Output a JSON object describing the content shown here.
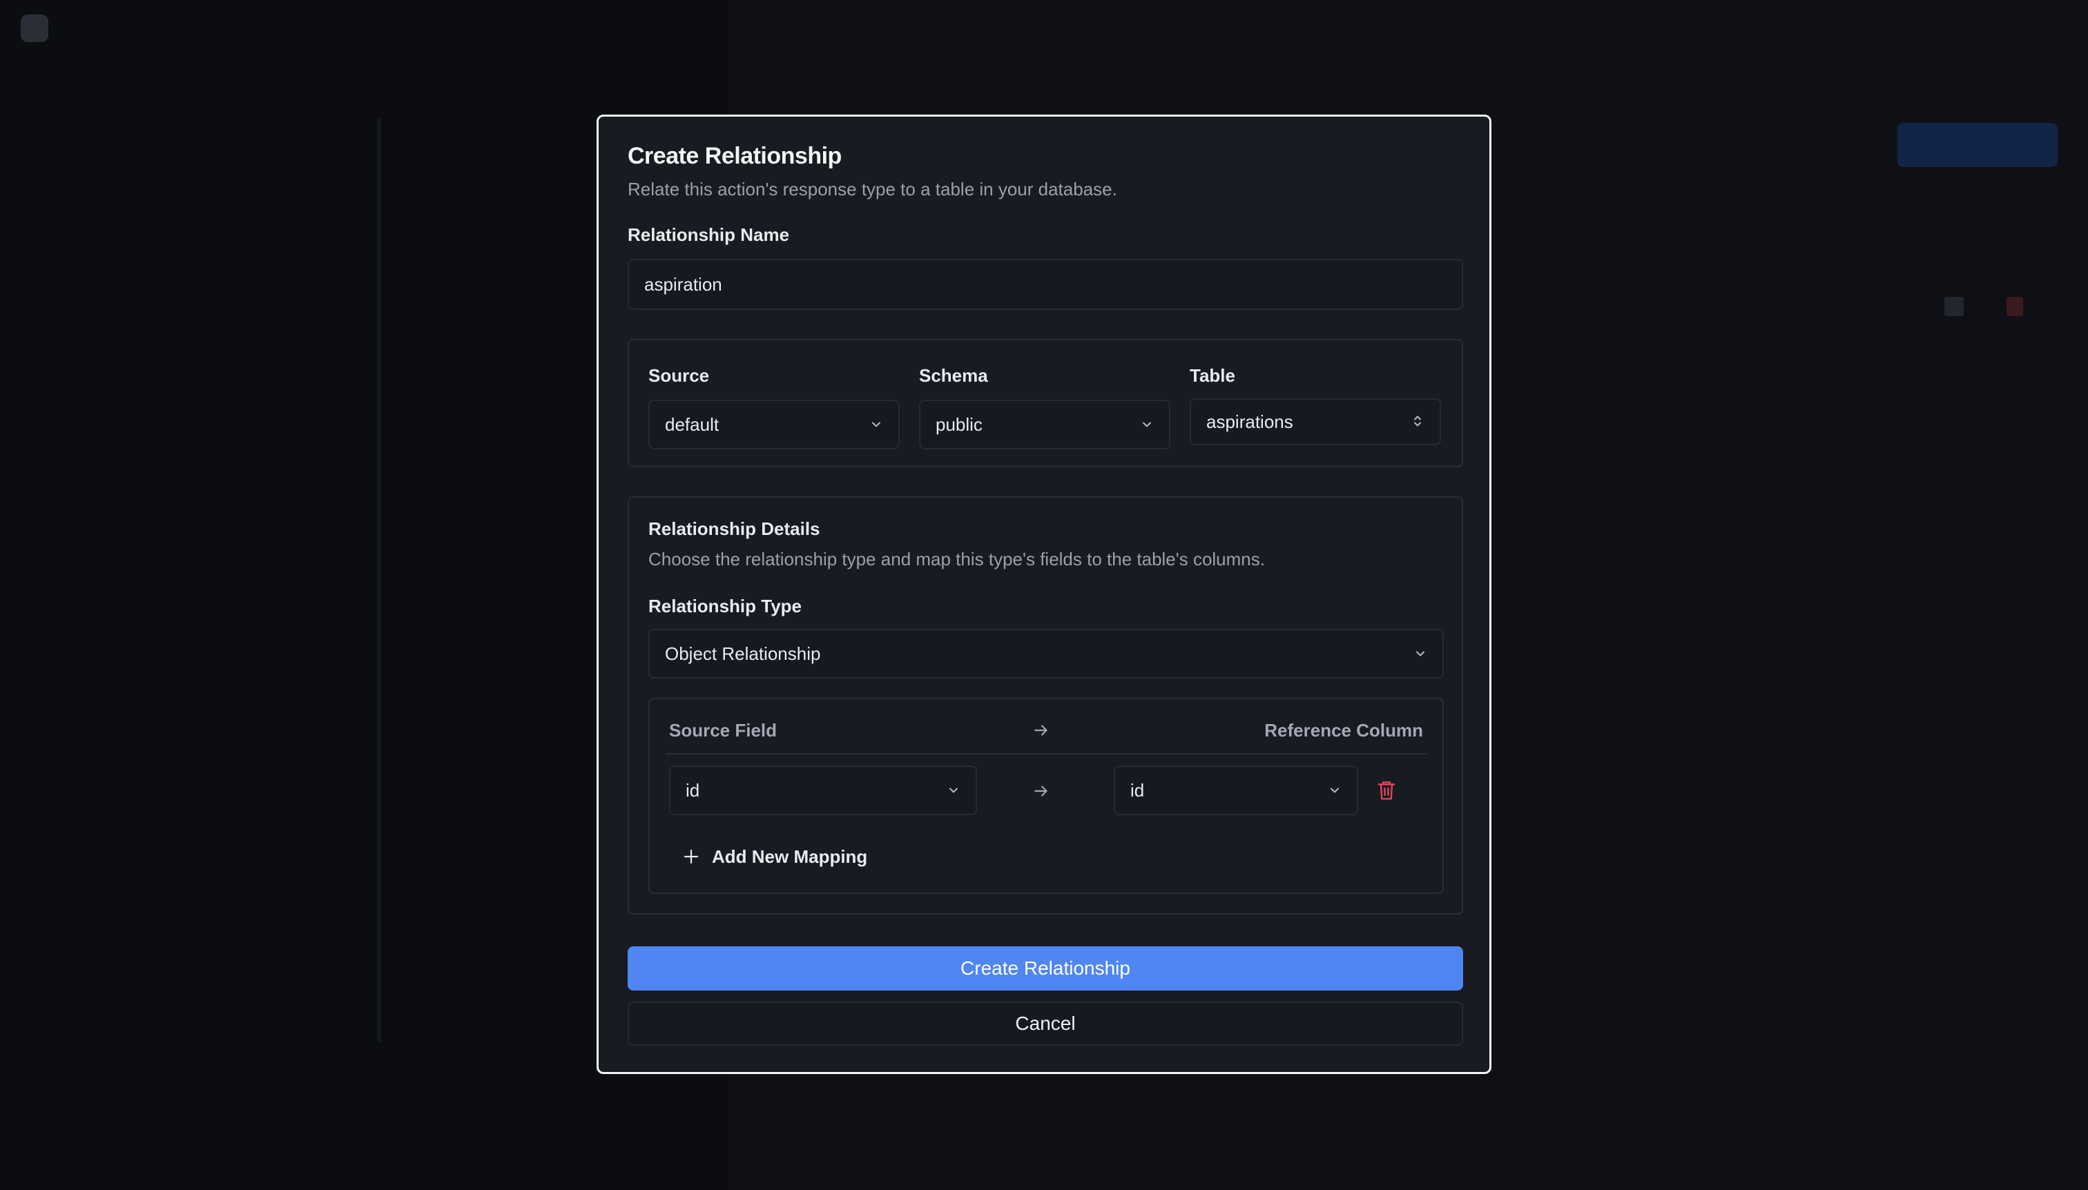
{
  "modal": {
    "title": "Create Relationship",
    "description": "Relate this action's response type to a table in your database.",
    "relationship_name": {
      "label": "Relationship Name",
      "value": "aspiration"
    },
    "source": {
      "label": "Source",
      "value": "default"
    },
    "schema": {
      "label": "Schema",
      "value": "public"
    },
    "table": {
      "label": "Table",
      "value": "aspirations"
    },
    "details": {
      "title": "Relationship Details",
      "description": "Choose the relationship type and map this type's fields to the table's columns.",
      "type_label": "Relationship Type",
      "type_value": "Object Relationship",
      "mapping": {
        "source_header": "Source Field",
        "reference_header": "Reference Column",
        "rows": [
          {
            "source": "id",
            "reference": "id"
          }
        ],
        "add_label": "Add New Mapping"
      }
    },
    "create_label": "Create Relationship",
    "cancel_label": "Cancel"
  },
  "colors": {
    "primary": "#4f86f2",
    "danger": "#e0425a",
    "modal_bg": "#181b22"
  },
  "icons": {
    "chevron": "chevron-down-icon",
    "updown": "chevron-up-down-icon",
    "arrow": "arrow-right-icon",
    "trash": "trash-icon",
    "plus": "plus-icon"
  }
}
